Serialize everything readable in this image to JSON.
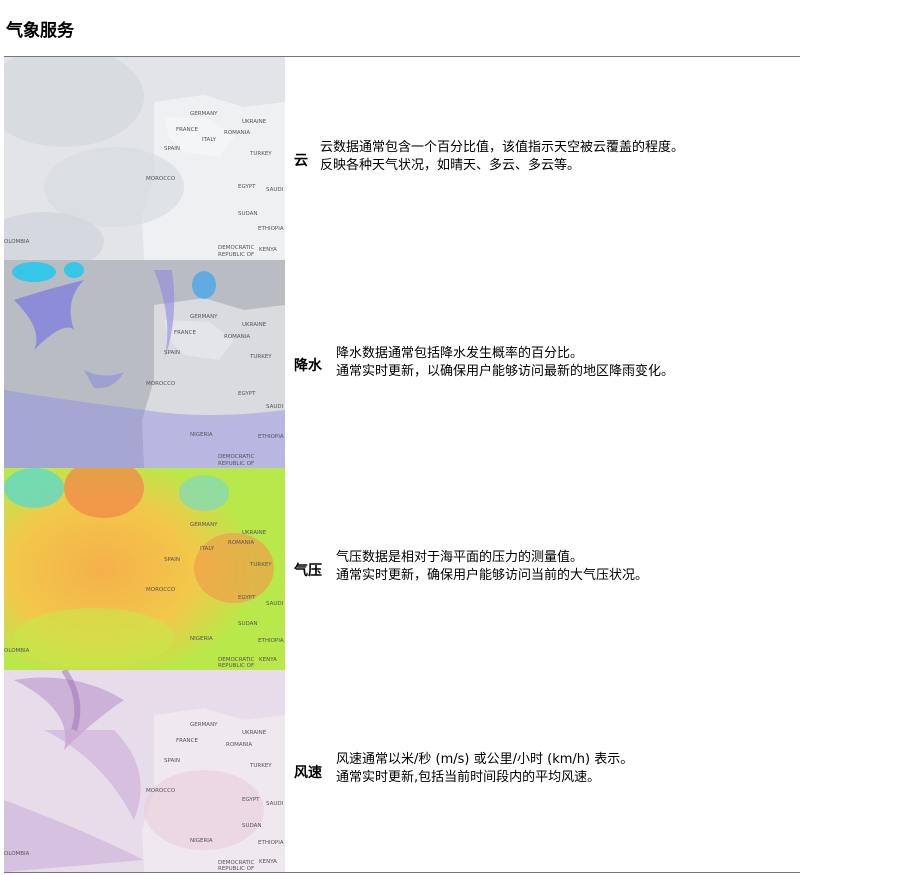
{
  "page": {
    "title": "气象服务"
  },
  "rows": [
    {
      "label": "云",
      "lines": [
        "云数据通常包含一个百分比值，该值指示天空被云覆盖的程度。",
        "反映各种天气状况，如晴天、多云、多云等。"
      ]
    },
    {
      "label": "降水",
      "lines": [
        "降水数据通常包括降水发生概率的百分比。",
        "通常实时更新，以确保用户能够访问最新的地区降雨变化。"
      ]
    },
    {
      "label": "气压",
      "lines": [
        "气压数据是相对于海平面的压力的测量值。",
        "通常实时更新，确保用户能够访问当前的大气压状况。"
      ]
    },
    {
      "label": "风速",
      "lines": [
        "风速通常以米/秒 (m/s) 或公里/小时 (km/h) 表示。",
        "通常实时更新,包括当前时间段内的平均风速。"
      ]
    }
  ],
  "map_labels": {
    "germany": "GERMANY",
    "ukraine": "UKRAINE",
    "france": "FRANCE",
    "romania": "ROMANIA",
    "spain": "SPAIN",
    "italy": "ITALY",
    "turkey": "TURKEY",
    "morocco": "MOROCCO",
    "egypt": "EGYPT",
    "sudan": "SUDAN",
    "saudi": "SAUDI",
    "ethiopia": "ETHIOPIA",
    "nigeria": "NIGERIA",
    "kenya": "KENYA",
    "drc": "DEMOCRATIC",
    "drc2": "REPUBLIC OF",
    "colombia": "OLOMBIA"
  }
}
